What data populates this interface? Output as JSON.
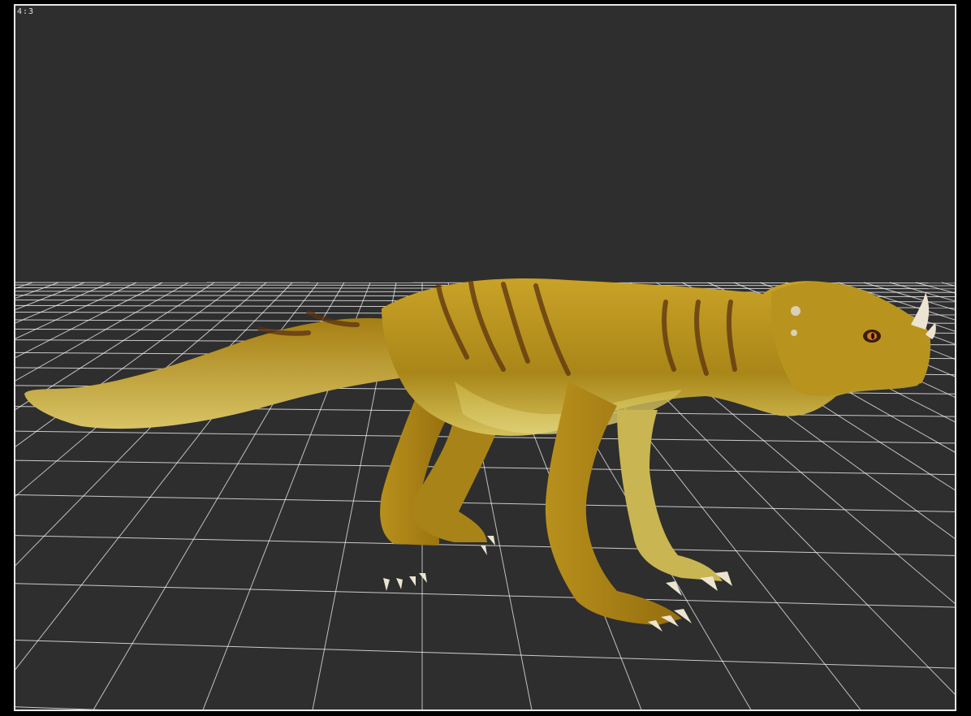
{
  "viewport": {
    "aspect_label": "4:3",
    "background_color": "#2e2e2e",
    "frame_color": "#e8e8e8",
    "grid_color": "#ffffff"
  },
  "scene": {
    "subject": "dinosaur-model",
    "skin_color": "#b89320",
    "stripe_color": "#5a3210",
    "claw_color": "#ece4d0"
  }
}
